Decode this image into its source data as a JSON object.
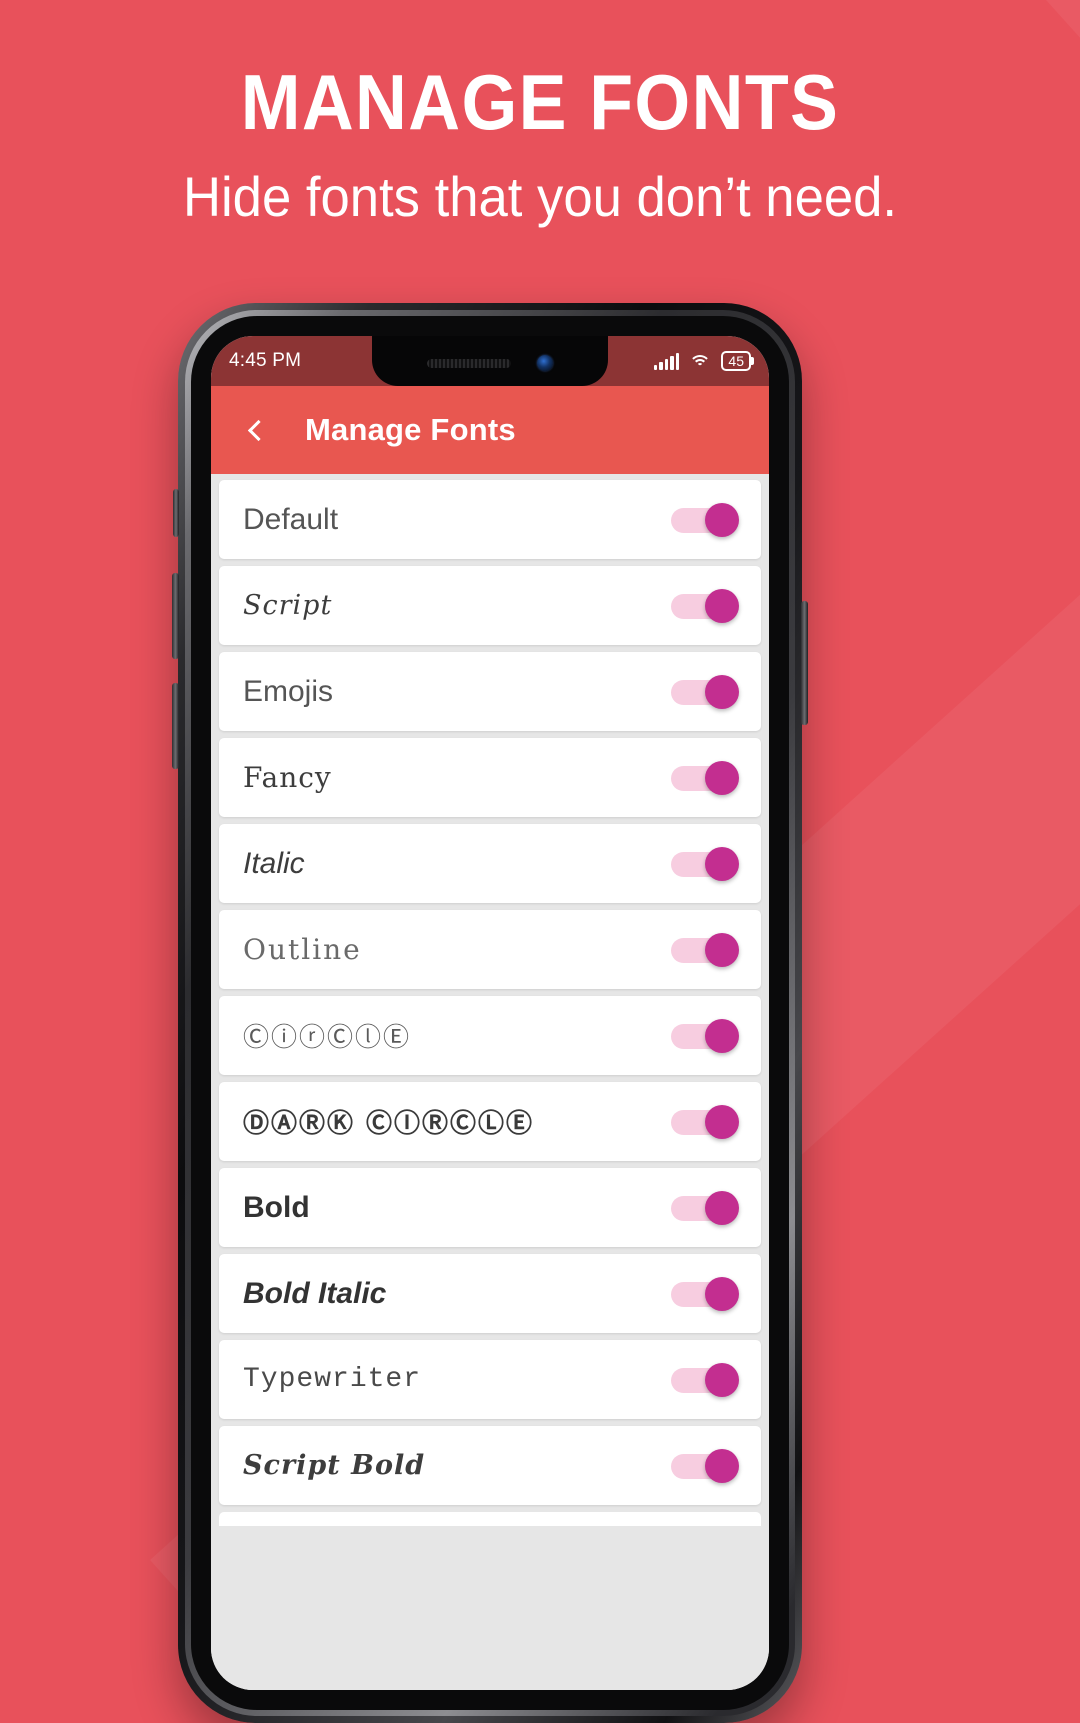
{
  "promo": {
    "title": "MANAGE FONTS",
    "subtitle": "Hide fonts that you don’t need.",
    "background_color": "#E8515B"
  },
  "phone": {
    "status_bar": {
      "time": "4:45 PM",
      "signal_icon": "signal-bars-icon",
      "wifi_icon": "wifi-icon",
      "battery_level": "45",
      "background_color": "#8C3434"
    },
    "app_bar": {
      "back_icon": "back-chevron-icon",
      "title": "Manage Fonts",
      "background_color": "#E85750"
    },
    "font_list": {
      "switch_track_color": "#F7CDE0",
      "switch_thumb_color": "#C32E90",
      "rows": [
        {
          "label": "Default",
          "style": "st-default",
          "enabled": true
        },
        {
          "label": "Script",
          "style": "st-script",
          "enabled": true
        },
        {
          "label": "Emojis",
          "style": "st-emoji",
          "enabled": true
        },
        {
          "label": "Fancy",
          "style": "st-fancy",
          "enabled": true
        },
        {
          "label": "Italic",
          "style": "st-italic",
          "enabled": true
        },
        {
          "label": "Outline",
          "style": "st-outline",
          "enabled": true
        },
        {
          "label": "ⒸⓘⓡⒸⓛⒺ",
          "style": "st-circle",
          "enabled": true
        },
        {
          "label": "ⒹⒶⓇⓀ ⒸⒾⓇⒸⓁⒺ",
          "style": "st-darkcirc",
          "enabled": true
        },
        {
          "label": "Bold",
          "style": "st-bold",
          "enabled": true
        },
        {
          "label": "Bold Italic",
          "style": "st-bolditalic",
          "enabled": true
        },
        {
          "label": "Typewriter",
          "style": "st-typewriter",
          "enabled": true
        },
        {
          "label": "Script Bold",
          "style": "st-scriptbold",
          "enabled": true
        }
      ]
    }
  }
}
